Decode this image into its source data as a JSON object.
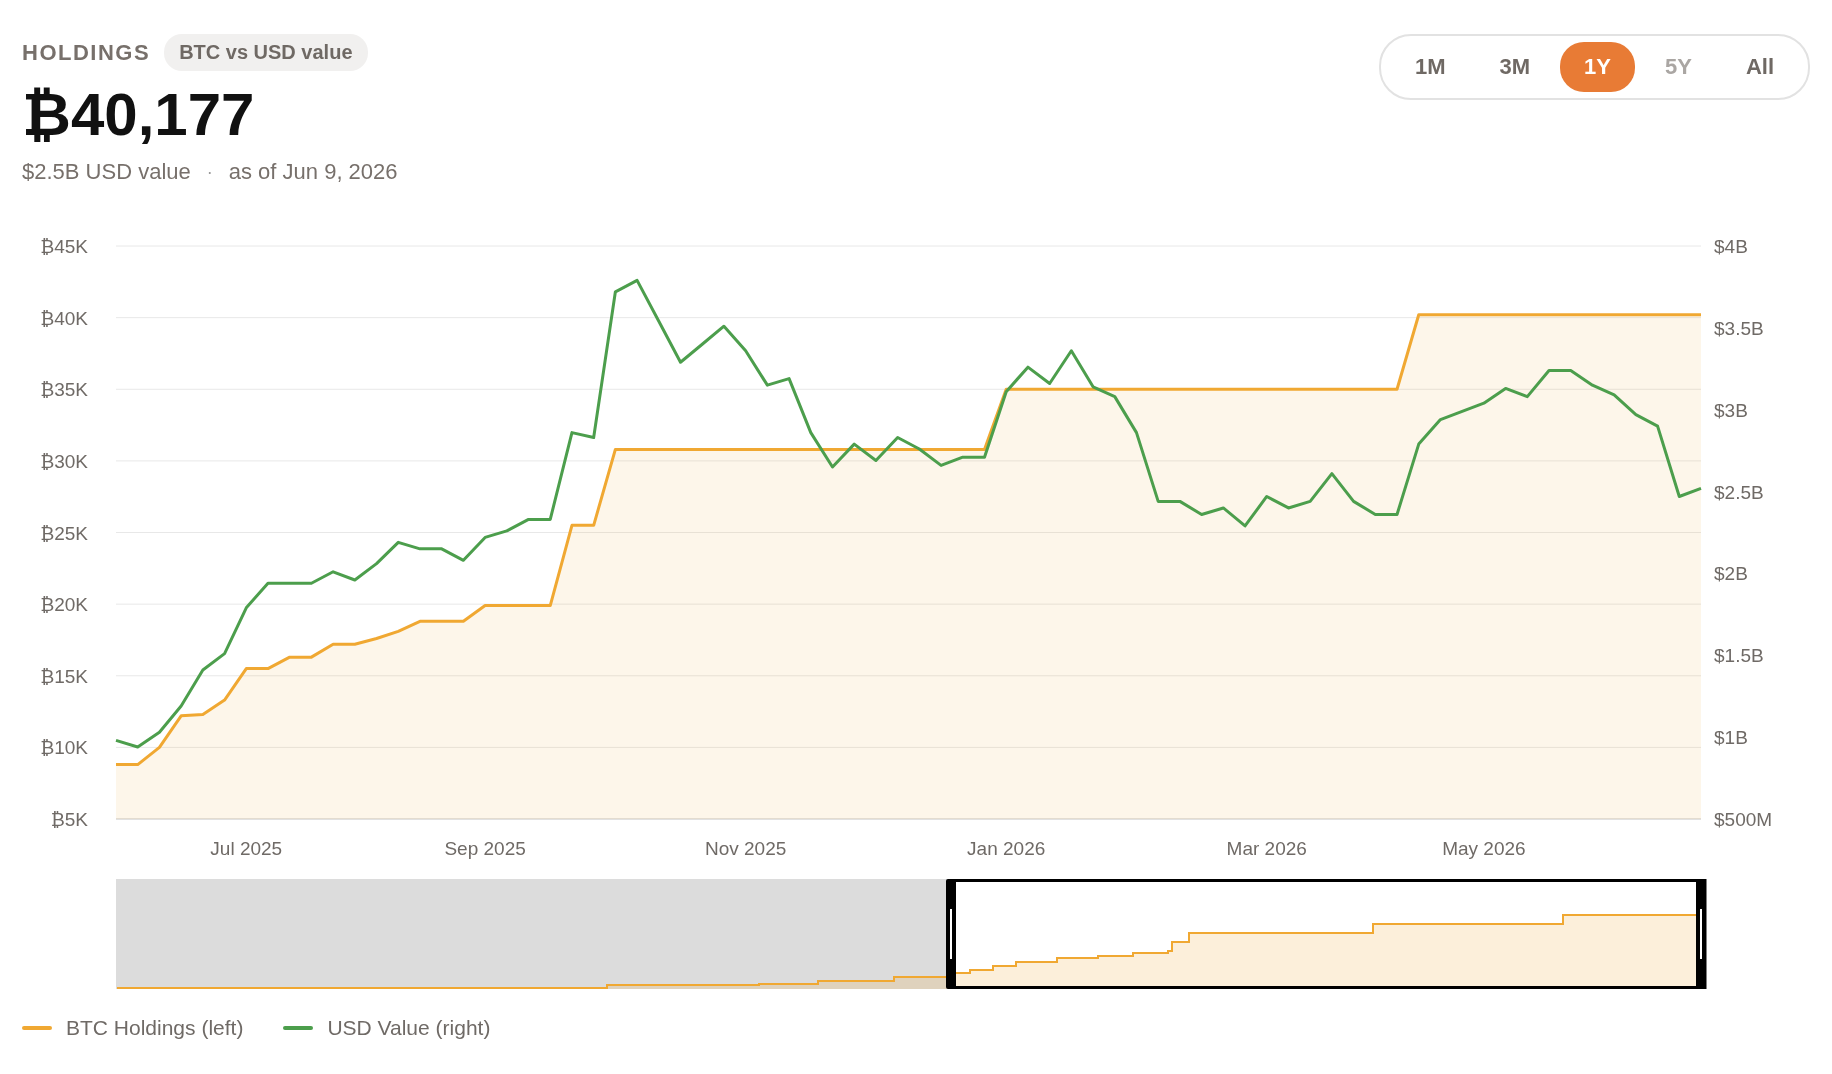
{
  "header": {
    "label": "HOLDINGS",
    "badge": "BTC vs USD value",
    "total": "₿40,177",
    "usd_value": "$2.5B USD value",
    "separator": "·",
    "as_of": "as of Jun 9, 2026"
  },
  "range_buttons": [
    {
      "label": "1M",
      "selected": false,
      "disabled": false
    },
    {
      "label": "3M",
      "selected": false,
      "disabled": false
    },
    {
      "label": "1Y",
      "selected": true,
      "disabled": false
    },
    {
      "label": "5Y",
      "selected": false,
      "disabled": true
    },
    {
      "label": "All",
      "selected": false,
      "disabled": false
    }
  ],
  "chart": {
    "chart_data": {
      "type": "line",
      "grid": true,
      "categories": [
        null,
        null,
        null,
        null,
        null,
        null,
        "Jul 2025",
        null,
        null,
        null,
        null,
        null,
        null,
        null,
        null,
        null,
        null,
        "Sep 2025",
        null,
        null,
        null,
        null,
        null,
        null,
        null,
        null,
        null,
        null,
        null,
        "Nov 2025",
        null,
        null,
        null,
        null,
        null,
        null,
        null,
        null,
        null,
        null,
        null,
        "Jan 2026",
        null,
        null,
        null,
        null,
        null,
        null,
        null,
        null,
        null,
        null,
        null,
        "Mar 2026",
        null,
        null,
        null,
        null,
        null,
        null,
        null,
        null,
        null,
        "May 2026",
        null,
        null,
        null,
        null,
        null,
        null,
        null,
        null,
        null,
        null
      ],
      "ylim": [
        5000,
        45000
      ],
      "yticks": [
        {
          "value": 45000,
          "label": "₿45K"
        },
        {
          "value": 40000,
          "label": "₿40K"
        },
        {
          "value": 35000,
          "label": "₿35K"
        },
        {
          "value": 30000,
          "label": "₿30K"
        },
        {
          "value": 25000,
          "label": "₿25K"
        },
        {
          "value": 20000,
          "label": "₿20K"
        },
        {
          "value": 15000,
          "label": "₿15K"
        },
        {
          "value": 10000,
          "label": "₿10K"
        },
        {
          "value": 5000,
          "label": "₿5K"
        }
      ],
      "y2lim": [
        500000000,
        4000000000
      ],
      "y2ticks": [
        {
          "value": 4000000000,
          "label": "$4B"
        },
        {
          "value": 3500000000,
          "label": "$3.5B"
        },
        {
          "value": 3000000000,
          "label": "$3B"
        },
        {
          "value": 2500000000,
          "label": "$2.5B"
        },
        {
          "value": 2000000000,
          "label": "$2B"
        },
        {
          "value": 1500000000,
          "label": "$1.5B"
        },
        {
          "value": 1000000000,
          "label": "$1B"
        },
        {
          "value": 500000000,
          "label": "$500M"
        }
      ],
      "series": [
        {
          "name": "BTC Holdings (left)",
          "color": "#f0a832",
          "type": "area",
          "values": [
            8800,
            8800,
            10000,
            12200,
            12300,
            13300,
            15500,
            15500,
            16300,
            16300,
            17200,
            17200,
            17600,
            18100,
            18800,
            18800,
            18800,
            19900,
            19900,
            19900,
            19900,
            25500,
            25500,
            30800,
            30800,
            30800,
            30800,
            30800,
            30800,
            30800,
            30800,
            30800,
            30800,
            30800,
            30800,
            30800,
            30800,
            30800,
            30800,
            30800,
            30800,
            35000,
            35000,
            35000,
            35000,
            35000,
            35000,
            35000,
            35000,
            35000,
            35000,
            35000,
            35000,
            35000,
            35000,
            35000,
            35000,
            35000,
            35000,
            35000,
            40200,
            40200,
            40200,
            40200,
            40200,
            40200,
            40200,
            40200,
            40200,
            40200,
            40200,
            40200,
            40200,
            40200
          ]
        },
        {
          "name": "USD Value (right)",
          "color": "#4c9e4c",
          "axis": "y2",
          "values": [
            980000000,
            940000000,
            1030000000,
            1190000000,
            1410000000,
            1510000000,
            1790000000,
            1940000000,
            1940000000,
            1940000000,
            2010000000,
            1960000000,
            2060000000,
            2190000000,
            2150000000,
            2150000000,
            2080000000,
            2220000000,
            2260000000,
            2330000000,
            2330000000,
            2860000000,
            2830000000,
            3720000000,
            3790000000,
            3540000000,
            3290000000,
            3400000000,
            3510000000,
            3360000000,
            3150000000,
            3190000000,
            2860000000,
            2650000000,
            2790000000,
            2690000000,
            2830000000,
            2760000000,
            2660000000,
            2710000000,
            2710000000,
            3110000000,
            3260000000,
            3160000000,
            3360000000,
            3140000000,
            3080000000,
            2860000000,
            2440000000,
            2440000000,
            2360000000,
            2400000000,
            2290000000,
            2470000000,
            2400000000,
            2440000000,
            2610000000,
            2440000000,
            2360000000,
            2360000000,
            2790000000,
            2940000000,
            2990000000,
            3040000000,
            3130000000,
            3080000000,
            3240000000,
            3240000000,
            3150000000,
            3090000000,
            2970000000,
            2900000000,
            2470000000,
            2520000000
          ]
        }
      ]
    }
  }
}
